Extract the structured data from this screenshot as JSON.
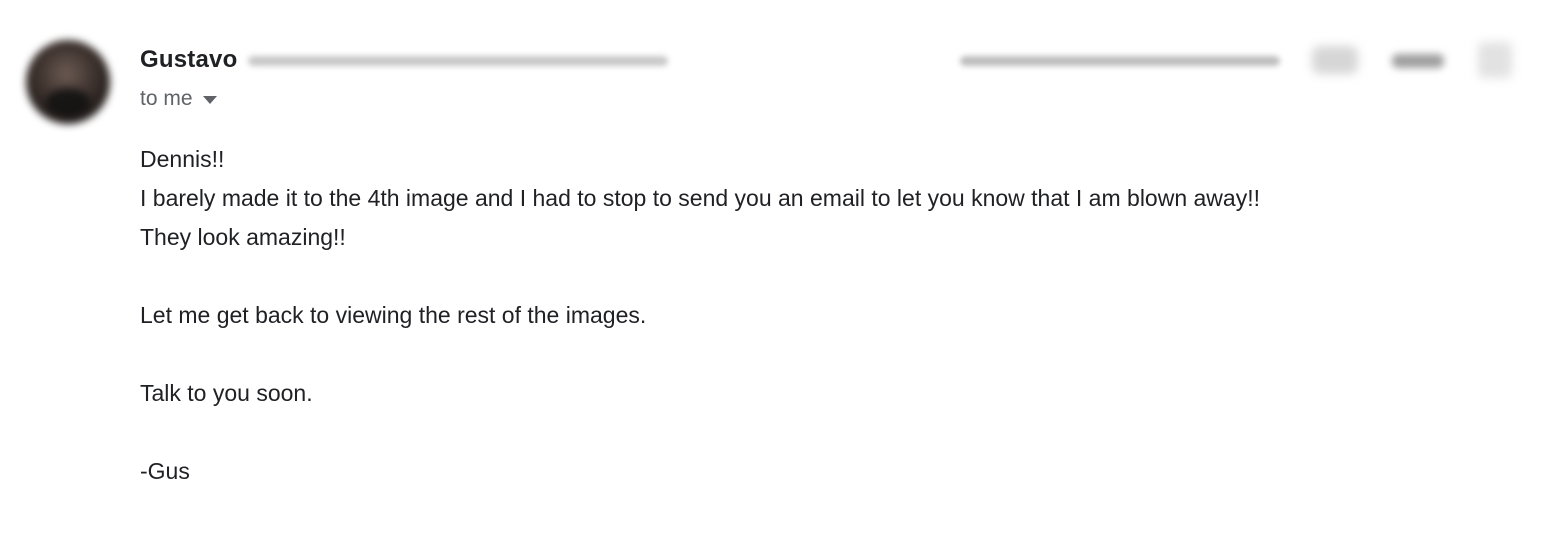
{
  "header": {
    "sender_name": "Gustavo",
    "recipient_label": "to me"
  },
  "body": {
    "line1": "Dennis!!",
    "line2": "I barely made it to the 4th image and I had to stop to send you an email to let you know that I am blown away!!",
    "line3": "They look amazing!!",
    "line4": "Let me get back to viewing the rest of the images.",
    "line5": "Talk to you soon.",
    "line6": "-Gus"
  },
  "icons": {
    "avatar": "avatar",
    "recipient_dropdown": "chevron-down-icon",
    "star": "star-icon",
    "reply": "reply-icon",
    "more": "more-vert-icon"
  },
  "colors": {
    "text": "#202124",
    "secondary_text": "#5f6368"
  }
}
